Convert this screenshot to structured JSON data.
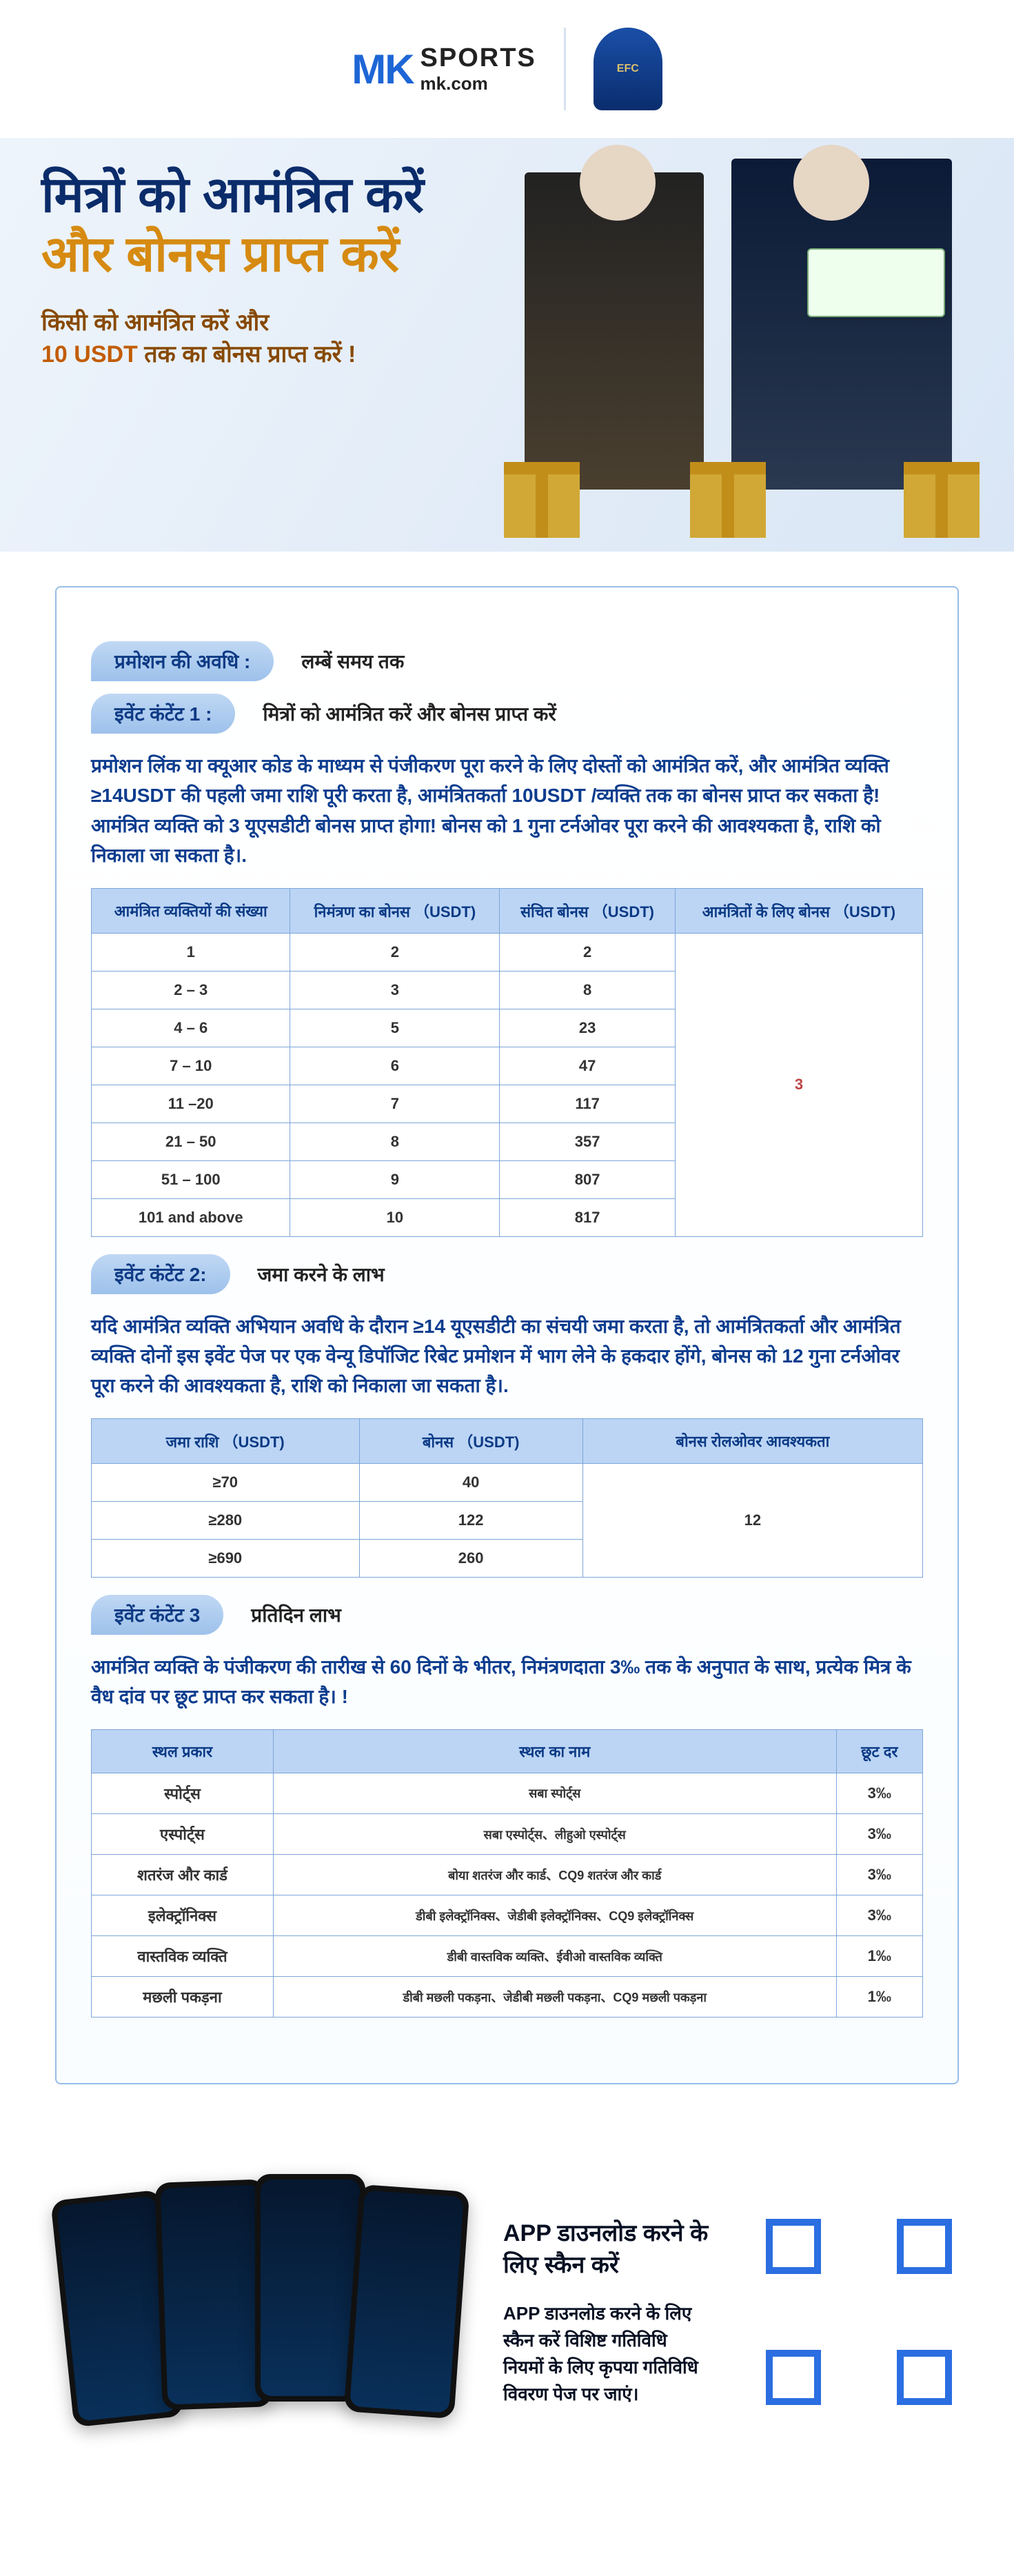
{
  "header": {
    "brand": "MK",
    "brand2": "SPORTS",
    "domain": "mk.com",
    "badge": "EFC"
  },
  "hero": {
    "l1": "मित्रों को आमंत्रित करें",
    "l2": "और बोनस प्राप्त करें",
    "sub_a": "किसी को आमंत्रित करें और",
    "sub_b": "10 USDT",
    "sub_c": " तक का बोनस प्राप्त करें !"
  },
  "sect": {
    "period_label": "प्रमोशन की अवधि :",
    "period_val": "लम्बें समय तक",
    "c1_label": "इवेंट कंटेंट 1 :",
    "c1_val": "मित्रों को आमंत्रित करें और बोनस प्राप्त करें",
    "c2_label": "इवेंट कंटेंट 2:",
    "c2_val": "जमा करने के लाभ",
    "c3_label": "इवेंट कंटेंट 3",
    "c3_val": "प्रतिदिन लाभ"
  },
  "p1": "प्रमोशन लिंक या क्यूआर कोड के माध्यम से पंजीकरण पूरा करने के लिए दोस्तों को आमंत्रित करें, और आमंत्रित व्यक्ति ≥14USDT की पहली जमा राशि पूरी करता है, आमंत्रितकर्ता 10USDT /व्यक्ति तक का बोनस प्राप्त कर सकता है! आमंत्रित व्यक्ति को 3 यूएसडीटी बोनस प्राप्त होगा! बोनस को 1 गुना टर्नओवर पूरा करने की आवश्यकता है, राशि को निकाला जा सकता है।.",
  "p2": "यदि आमंत्रित व्यक्ति अभियान अवधि के दौरान ≥14 यूएसडीटी का संचयी जमा करता है, तो आमंत्रितकर्ता और आमंत्रित व्यक्ति दोनों इस इवेंट पेज पर एक वेन्यू डिपॉजिट रिबेट प्रमोशन में भाग लेने के हकदार होंगे, बोनस को 12 गुना टर्नओवर पूरा करने की आवश्यकता है, राशि को निकाला जा सकता है।.",
  "p3": "आमंत्रित व्यक्ति के पंजीकरण की तारीख से 60 दिनों के भीतर, निमंत्रणदाता 3‰ तक के अनुपात के साथ, प्रत्येक मित्र के वैध दांव पर छूट प्राप्त कर सकता है। !",
  "t1": {
    "h": [
      "आमंत्रित व्यक्तियों की संख्या",
      "निमंत्रण का बोनस （USDT)",
      "संचित बोनस （USDT)",
      "आमंत्रितों के लिए बोनस （USDT)"
    ],
    "r": [
      [
        "1",
        "2",
        "2"
      ],
      [
        "2 – 3",
        "3",
        "8"
      ],
      [
        "4 – 6",
        "5",
        "23"
      ],
      [
        "7 – 10",
        "6",
        "47"
      ],
      [
        "11 –20",
        "7",
        "117"
      ],
      [
        "21 – 50",
        "8",
        "357"
      ],
      [
        "51 – 100",
        "9",
        "807"
      ],
      [
        "101 and above",
        "10",
        "817"
      ]
    ],
    "merge": "3"
  },
  "t2": {
    "h": [
      "जमा राशि （USDT)",
      "बोनस （USDT)",
      "बोनस रोलओवर आवश्यकता"
    ],
    "r": [
      [
        "≥70",
        "40"
      ],
      [
        "≥280",
        "122"
      ],
      [
        "≥690",
        "260"
      ]
    ],
    "merge": "12"
  },
  "t3": {
    "h": [
      "स्थल प्रकार",
      "स्थल का नाम",
      "छूट दर"
    ],
    "r": [
      [
        "स्पोर्ट्स",
        "सबा स्पोर्ट्स",
        "3‰"
      ],
      [
        "एस्पोर्ट्स",
        "सबा एस्पोर्ट्स、लीहुओ एस्पोर्ट्स",
        "3‰"
      ],
      [
        "शतरंज और कार्ड",
        "बोया शतरंज और कार्ड、CQ9 शतरंज और कार्ड",
        "3‰"
      ],
      [
        "इलेक्ट्रॉनिक्स",
        "डीबी इलेक्ट्रॉनिक्स、जेडीबी इलेक्ट्रॉनिक्स、CQ9 इलेक्ट्रॉनिक्स",
        "3‰"
      ],
      [
        "वास्तविक व्यक्ति",
        "डीबी वास्तविक व्यक्ति、ईवीओ वास्तविक व्यक्ति",
        "1‰"
      ],
      [
        "मछली पकड़ना",
        "डीबी मछली पकड़ना、जेडीबी मछली पकड़ना、CQ9 मछली पकड़ना",
        "1‰"
      ]
    ]
  },
  "dl": {
    "h": "APP  डाउनलोड करने के लिए स्कैन करें",
    "p": "APP  डाउनलोड करने के लिए स्कैन करें विशिष्ट गतिविधि नियमों के लिए कृपया गतिविधि विवरण पेज पर जाएं।"
  }
}
